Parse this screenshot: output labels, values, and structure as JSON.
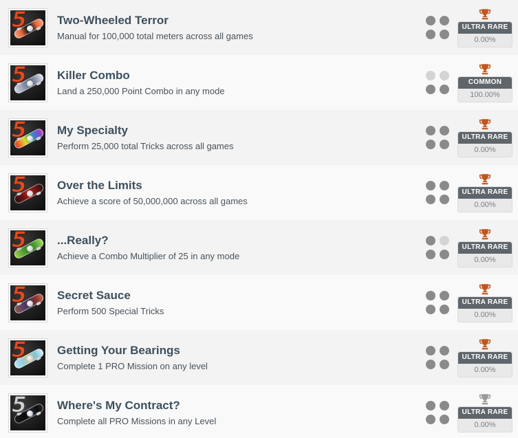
{
  "colors": {
    "title_text": "#3d4f5d",
    "desc_text": "#49525a",
    "row_light": "#f9f9f9",
    "row_dark": "#f3f3f3",
    "badge_header": "#5e656b",
    "badge_body": "#e9e9e9",
    "trophy_bronze": "#c0561f",
    "trophy_silver": "#9a9a9a",
    "dot_filled": "#8a8a8a",
    "dot_empty": "#d4d4d4",
    "logo_orange": "#e8491d",
    "logo_silver": "#cfcfcf"
  },
  "trophies": [
    {
      "title": "Two-Wheeled Terror",
      "description": "Manual for 100,000 total meters across all games",
      "rarity": "ULTRA RARE",
      "percent": "0.00%",
      "trophy_type": "bronze",
      "dots": [
        "filled",
        "filled",
        "filled",
        "filled"
      ],
      "thumb": {
        "logo": "5",
        "logo_color": "#e8491d",
        "deck_gradient": "linear-gradient(90deg,#f0a07a 0%,#e8663a 22%,#1f1f1f 42%,#1f1f1f 58%,#e8663a 78%,#f0a07a 100%)",
        "icon_name": "skateboard-orange-stripes"
      }
    },
    {
      "title": "Killer Combo",
      "description": "Land a 250,000 Point Combo in any mode",
      "rarity": "COMMON",
      "percent": "100.00%",
      "trophy_type": "bronze",
      "dots": [
        "empty",
        "empty",
        "filled",
        "filled"
      ],
      "thumb": {
        "logo": "5",
        "logo_color": "#e8491d",
        "deck_gradient": "linear-gradient(90deg,#cfd5e0 0%,#8d96ad 30%,#5a6380 55%,#9aa3b8 80%,#dfe3ec 100%)",
        "icon_name": "skateboard-blue-grey"
      }
    },
    {
      "title": "My Specialty",
      "description": "Perform 25,000 total Tricks across all games",
      "rarity": "ULTRA RARE",
      "percent": "0.00%",
      "trophy_type": "bronze",
      "dots": [
        "filled",
        "filled",
        "filled",
        "filled"
      ],
      "thumb": {
        "logo": "5",
        "logo_color": "#e8491d",
        "deck_gradient": "linear-gradient(90deg,#e03b2e 0%,#e8852c 18%,#e8d22c 34%,#4fb84a 52%,#3a7fd5 70%,#8a45c9 88%,#c94fc9 100%)",
        "icon_name": "skateboard-rainbow"
      }
    },
    {
      "title": "Over the Limits",
      "description": "Achieve a score of 50,000,000 across all games",
      "rarity": "ULTRA RARE",
      "percent": "0.00%",
      "trophy_type": "bronze",
      "dots": [
        "filled",
        "filled",
        "filled",
        "filled"
      ],
      "thumb": {
        "logo": "5",
        "logo_color": "#e8491d",
        "deck_gradient": "linear-gradient(90deg,#2a1010 0%,#6b1414 28%,#c41f1f 50%,#7a1818 72%,#2a1010 100%)",
        "icon_name": "skateboard-red-dark"
      }
    },
    {
      "title": "...Really?",
      "description": "Achieve a Combo Multiplier of 25 in any mode",
      "rarity": "ULTRA RARE",
      "percent": "0.00%",
      "trophy_type": "bronze",
      "dots": [
        "filled",
        "empty",
        "filled",
        "filled"
      ],
      "thumb": {
        "logo": "5",
        "logo_color": "#e8491d",
        "deck_gradient": "linear-gradient(90deg,#9ccf4f 0%,#4f9b2e 30%,#2f7a1e 55%,#5fae38 80%,#a9d862 100%)",
        "icon_name": "skateboard-green-questions"
      }
    },
    {
      "title": "Secret Sauce",
      "description": "Perform 500 Special Tricks",
      "rarity": "ULTRA RARE",
      "percent": "0.00%",
      "trophy_type": "bronze",
      "dots": [
        "filled",
        "filled",
        "filled",
        "filled"
      ],
      "thumb": {
        "logo": "5",
        "logo_color": "#e8491d",
        "deck_gradient": "linear-gradient(90deg,#8a5a4a 0%,#5a3f6b 28%,#3c3356 50%,#8a2f2f 76%,#c06a4a 100%)",
        "icon_name": "skateboard-maroon-purple"
      }
    },
    {
      "title": "Getting Your Bearings",
      "description": "Complete 1 PRO Mission on any level",
      "rarity": "ULTRA RARE",
      "percent": "0.00%",
      "trophy_type": "bronze",
      "dots": [
        "filled",
        "filled",
        "filled",
        "filled"
      ],
      "thumb": {
        "logo": "5",
        "logo_color": "#e8491d",
        "deck_gradient": "linear-gradient(90deg,#bfe3ef 0%,#8fd0e0 25%,#cfc68a 50%,#7fc4d8 75%,#d8eef5 100%)",
        "icon_name": "skateboard-world-map"
      }
    },
    {
      "title": "Where's My Contract?",
      "description": "Complete all PRO Missions in any Level",
      "rarity": "ULTRA RARE",
      "percent": "0.00%",
      "trophy_type": "silver",
      "dots": [
        "filled",
        "filled",
        "filled",
        "filled"
      ],
      "thumb": {
        "logo": "5",
        "logo_color": "#cfcfcf",
        "deck_gradient": "linear-gradient(90deg,#1a1a1a 0%,#0a0a0a 35%,#2a2f45 55%,#0d0d0d 80%,#242424 100%)",
        "icon_name": "skateboard-black-silver"
      }
    }
  ]
}
